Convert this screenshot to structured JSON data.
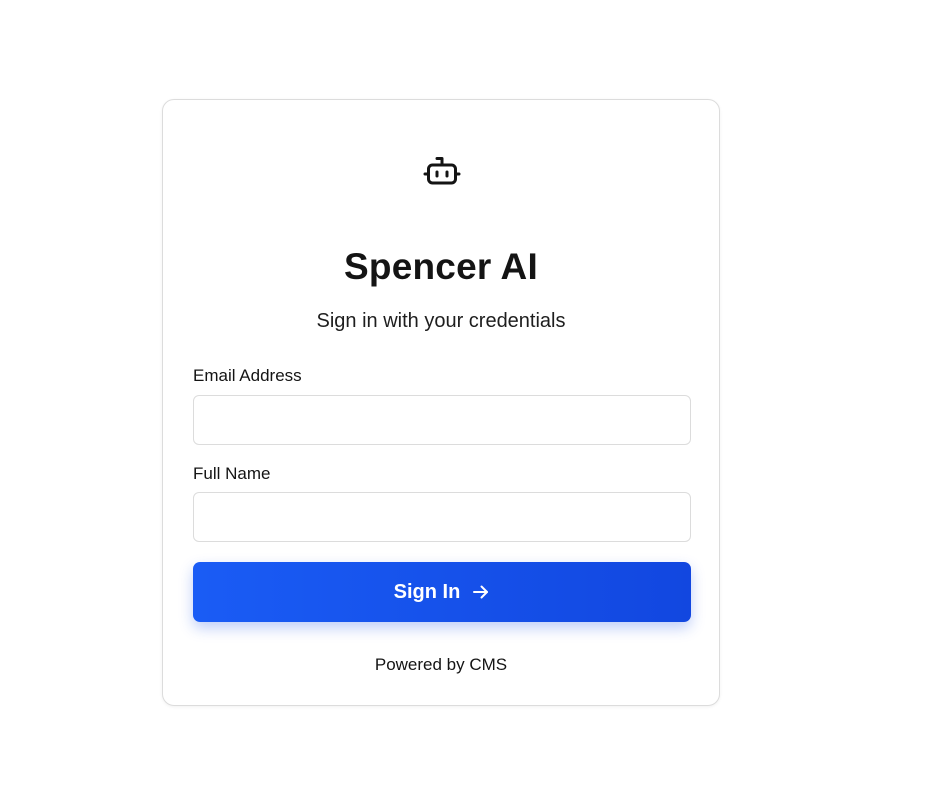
{
  "app": {
    "title": "Spencer AI",
    "subtitle": "Sign in with your credentials",
    "logo_icon": "robot-icon"
  },
  "form": {
    "email_label": "Email Address",
    "email_value": "",
    "email_placeholder": "",
    "name_label": "Full Name",
    "name_value": "",
    "name_placeholder": "",
    "submit_label": "Sign In",
    "submit_icon": "arrow-right-icon"
  },
  "footer": {
    "text": "Powered by CMS"
  },
  "colors": {
    "accent": "#1a5cf5",
    "accent_dark": "#1247e0",
    "border": "#dcdcdc",
    "text": "#141414"
  }
}
